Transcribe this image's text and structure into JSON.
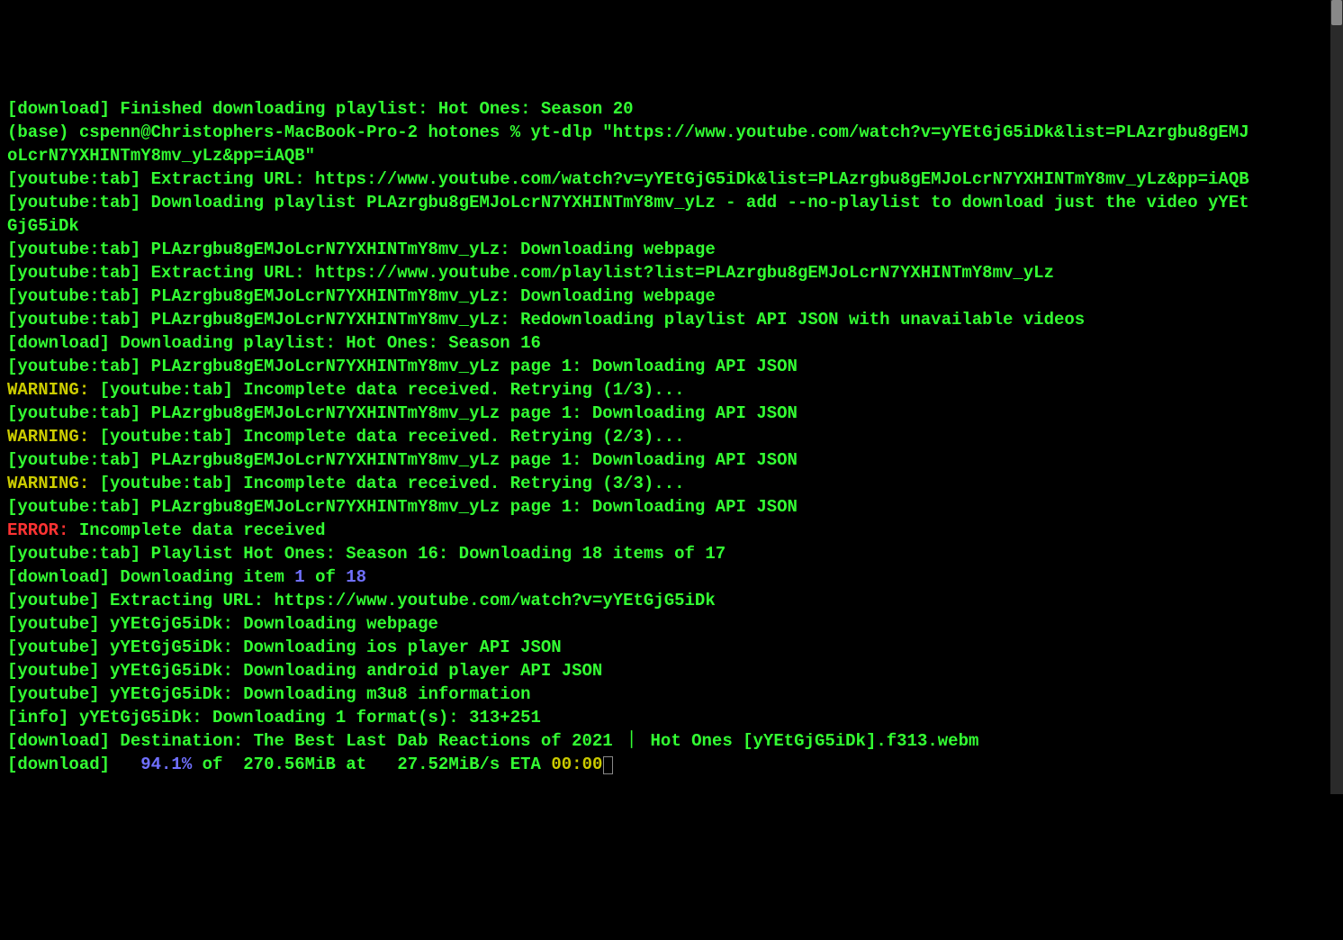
{
  "lines": {
    "l1": "[download] Finished downloading playlist: Hot Ones: Season 20",
    "l2": "(base) cspenn@Christophers-MacBook-Pro-2 hotones % yt-dlp \"https://www.youtube.com/watch?v=yYEtGjG5iDk&list=PLAzrgbu8gEMJoLcrN7YXHINTmY8mv_yLz&pp=iAQB\"",
    "l3": "[youtube:tab] Extracting URL: https://www.youtube.com/watch?v=yYEtGjG5iDk&list=PLAzrgbu8gEMJoLcrN7YXHINTmY8mv_yLz&pp=iAQB",
    "l4": "[youtube:tab] Downloading playlist PLAzrgbu8gEMJoLcrN7YXHINTmY8mv_yLz - add --no-playlist to download just the video yYEtGjG5iDk",
    "l5": "[youtube:tab] PLAzrgbu8gEMJoLcrN7YXHINTmY8mv_yLz: Downloading webpage",
    "l6": "[youtube:tab] Extracting URL: https://www.youtube.com/playlist?list=PLAzrgbu8gEMJoLcrN7YXHINTmY8mv_yLz",
    "l7": "[youtube:tab] PLAzrgbu8gEMJoLcrN7YXHINTmY8mv_yLz: Downloading webpage",
    "l8": "[youtube:tab] PLAzrgbu8gEMJoLcrN7YXHINTmY8mv_yLz: Redownloading playlist API JSON with unavailable videos",
    "l9": "[download] Downloading playlist: Hot Ones: Season 16",
    "l10": "[youtube:tab] PLAzrgbu8gEMJoLcrN7YXHINTmY8mv_yLz page 1: Downloading API JSON",
    "l11a": "WARNING:",
    "l11b": " [youtube:tab] Incomplete data received. Retrying (1/3)...",
    "l12": "[youtube:tab] PLAzrgbu8gEMJoLcrN7YXHINTmY8mv_yLz page 1: Downloading API JSON",
    "l13a": "WARNING:",
    "l13b": " [youtube:tab] Incomplete data received. Retrying (2/3)...",
    "l14": "[youtube:tab] PLAzrgbu8gEMJoLcrN7YXHINTmY8mv_yLz page 1: Downloading API JSON",
    "l15a": "WARNING:",
    "l15b": " [youtube:tab] Incomplete data received. Retrying (3/3)...",
    "l16": "[youtube:tab] PLAzrgbu8gEMJoLcrN7YXHINTmY8mv_yLz page 1: Downloading API JSON",
    "l17a": "ERROR:",
    "l17b": " Incomplete data received",
    "l18": "[youtube:tab] Playlist Hot Ones: Season 16: Downloading 18 items of 17",
    "l19a": "[download] Downloading item ",
    "l19b": "1",
    "l19c": " of ",
    "l19d": "18",
    "l20": "[youtube] Extracting URL: https://www.youtube.com/watch?v=yYEtGjG5iDk",
    "l21": "[youtube] yYEtGjG5iDk: Downloading webpage",
    "l22": "[youtube] yYEtGjG5iDk: Downloading ios player API JSON",
    "l23": "[youtube] yYEtGjG5iDk: Downloading android player API JSON",
    "l24": "[youtube] yYEtGjG5iDk: Downloading m3u8 information",
    "l25": "[info] yYEtGjG5iDk: Downloading 1 format(s): 313+251",
    "l26": "[download] Destination: The Best Last Dab Reactions of 2021 ｜ Hot Ones [yYEtGjG5iDk].f313.webm",
    "l27a": "[download]  ",
    "l27b": " 94.1%",
    "l27c": " of  ",
    "l27d": "270.56MiB",
    "l27e": " at   ",
    "l27f": "27.52MiB/s",
    "l27g": " ETA ",
    "l27h": "00:00"
  }
}
